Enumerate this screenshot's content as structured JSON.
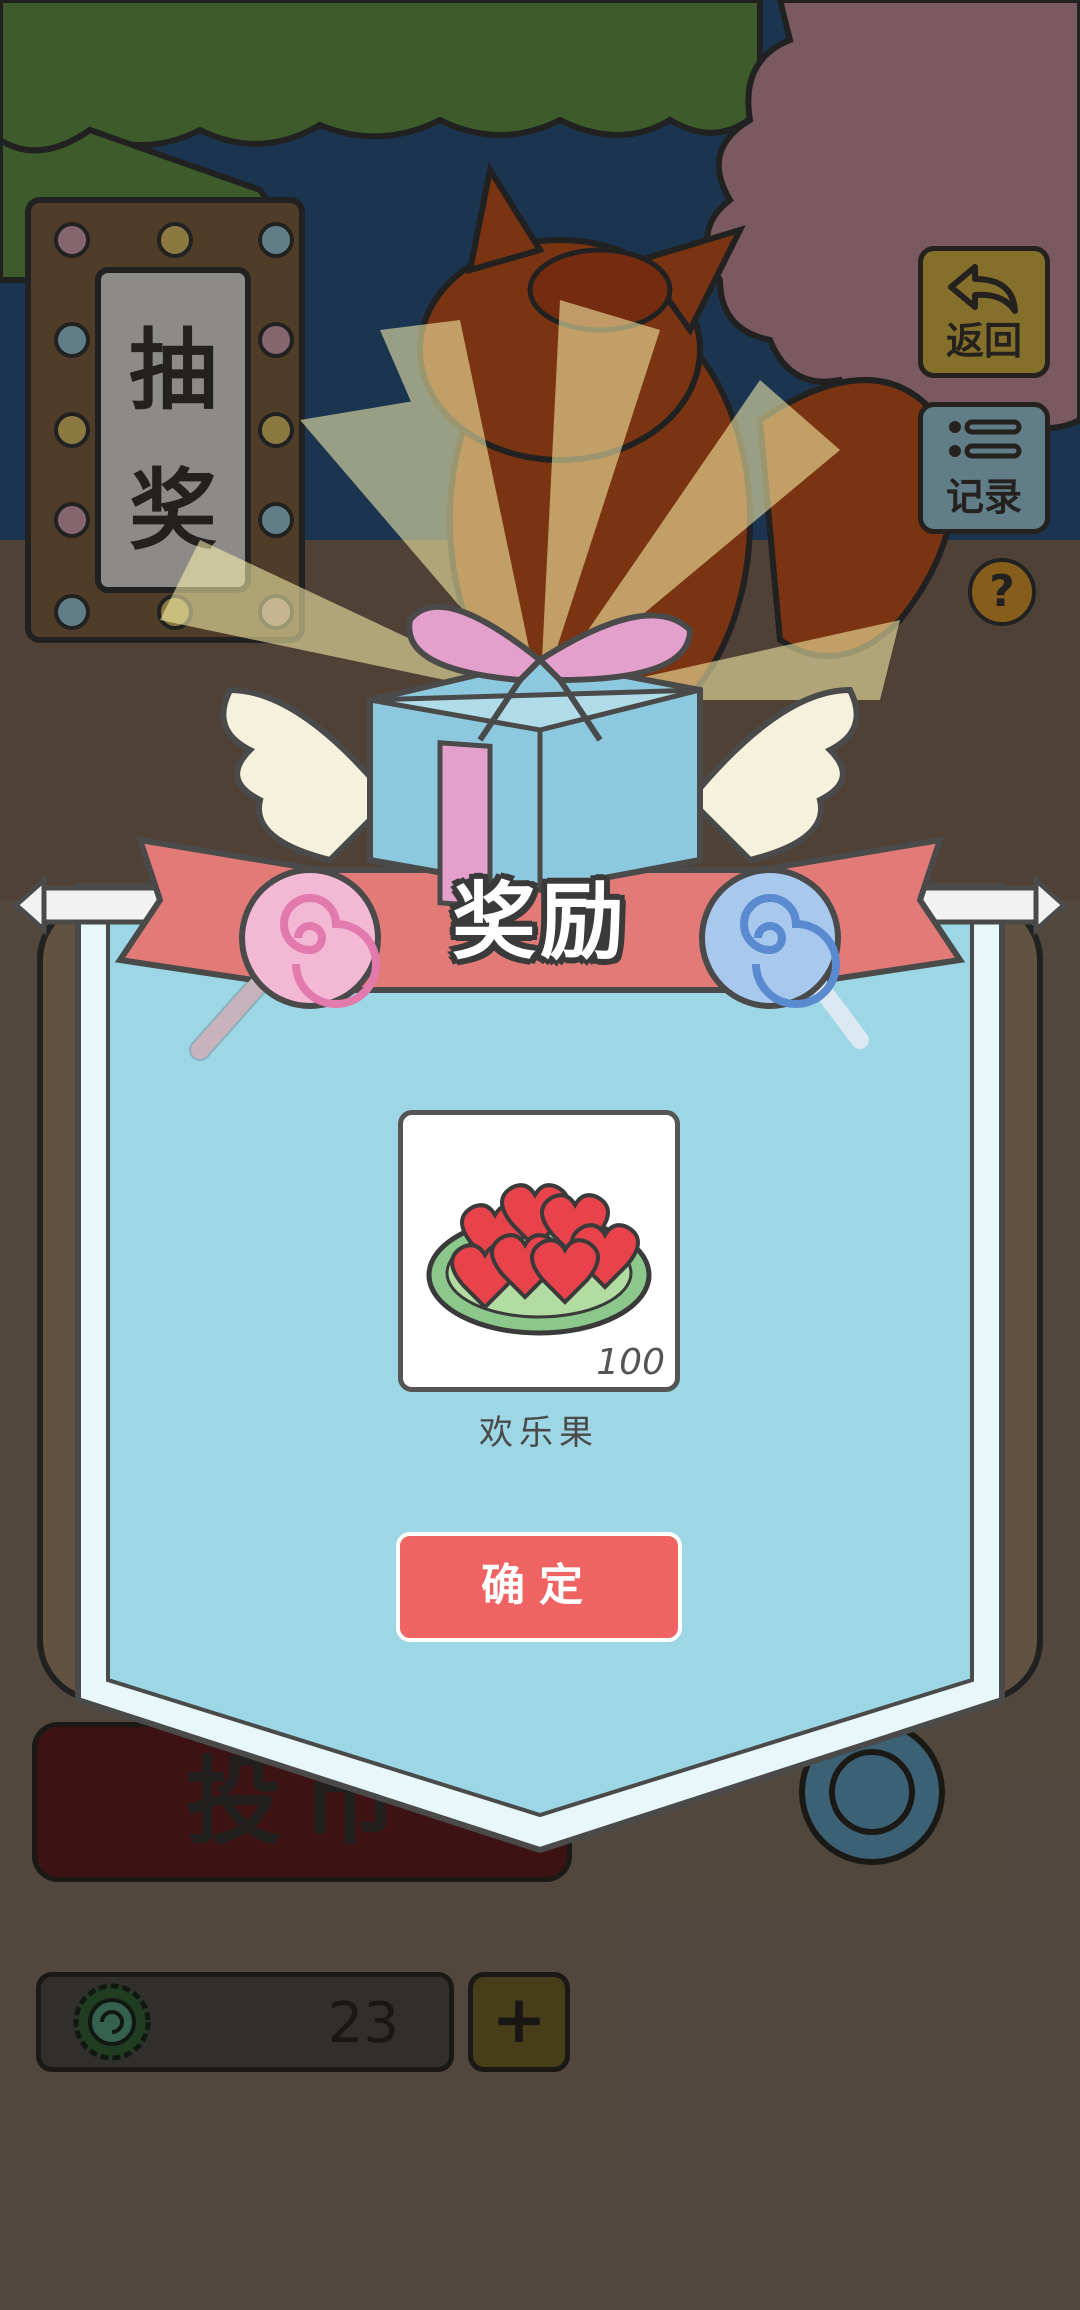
{
  "sign": {
    "line1": "抽",
    "line2": "奖"
  },
  "buttons": {
    "back_label": "返回",
    "records_label": "记录",
    "help_label": "?",
    "spin_label": "投币",
    "plus_label": "+"
  },
  "currency": {
    "value": "23",
    "icon": "coin-swirl-icon"
  },
  "dialog": {
    "title": "奖励",
    "reward": {
      "name": "欢乐果",
      "quantity": "100",
      "icon": "heart-fruit-plate-icon"
    },
    "confirm_label": "确定"
  },
  "colors": {
    "banner_fill": "#9dd6e4",
    "ribbon": "#e27a78",
    "confirm": "#ef6363",
    "gift_box": "#8cc9de",
    "gift_ribbon": "#e4a0cc"
  }
}
